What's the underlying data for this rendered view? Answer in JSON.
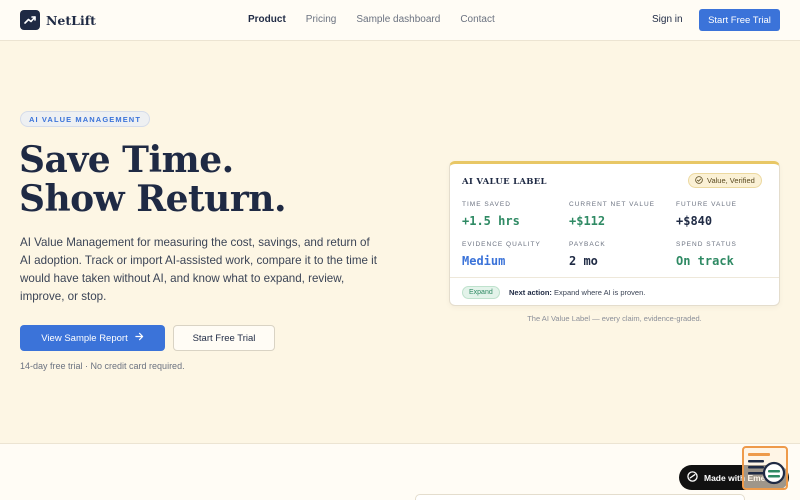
{
  "brand": {
    "name": "NetLift",
    "logo_icon": "trend-up-icon"
  },
  "nav": {
    "links": [
      {
        "label": "Product",
        "active": true
      },
      {
        "label": "Pricing",
        "active": false
      },
      {
        "label": "Sample dashboard",
        "active": false
      },
      {
        "label": "Contact",
        "active": false
      }
    ],
    "signin": "Sign in",
    "cta": "Start Free Trial"
  },
  "hero": {
    "eyebrow": "AI VALUE MANAGEMENT",
    "title_line1": "Save Time.",
    "title_line2": "Show Return.",
    "lede": "AI Value Management for measuring the cost, savings, and return of AI adoption. Track or import AI-assisted work, compare it to the time it would have taken without AI, and know what to expand, review, improve, or stop.",
    "primary_cta": "View Sample Report",
    "primary_cta_icon": "arrow-right-icon",
    "secondary_cta": "Start Free Trial",
    "trial_note": "14-day free trial · No credit card required."
  },
  "card": {
    "title": "AI VALUE LABEL",
    "badge": "Value, Verified",
    "badge_icon": "check-circle-icon",
    "metrics": [
      {
        "label": "TIME SAVED",
        "value": "+1.5 hrs",
        "tone": "green"
      },
      {
        "label": "CURRENT NET VALUE",
        "value": "+$112",
        "tone": "green"
      },
      {
        "label": "FUTURE VALUE",
        "value": "+$840",
        "tone": "dark"
      },
      {
        "label": "EVIDENCE QUALITY",
        "value": "Medium",
        "tone": "blue"
      },
      {
        "label": "PAYBACK",
        "value": "2 mo",
        "tone": "dark"
      },
      {
        "label": "SPEND STATUS",
        "value": "On track",
        "tone": "green"
      }
    ],
    "tag": "Expand",
    "next_action_label": "Next action:",
    "next_action_text": "Expand where AI is proven.",
    "caption": "The AI Value Label — every claim, evidence-graded."
  },
  "made_badge": {
    "label": "Made with Eme",
    "icon": "emergent-logo-icon"
  },
  "colors": {
    "accent": "#3b73d9",
    "navy": "#1f2a44",
    "green": "#2f8a64",
    "gold": "#e8c765",
    "background": "#fdf6e4"
  }
}
